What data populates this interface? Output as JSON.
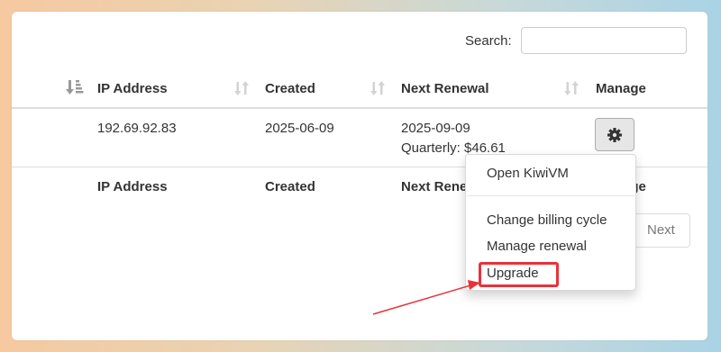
{
  "search": {
    "label": "Search:",
    "value": "",
    "placeholder": ""
  },
  "table": {
    "headers": [
      "IP Address",
      "Created",
      "Next Renewal",
      "Manage"
    ],
    "rows": [
      {
        "ip": "192.69.92.83",
        "created": "2025-06-09",
        "renewal_date": "2025-09-09",
        "renewal_cost": "Quarterly: $46.61"
      }
    ],
    "footer_headers": [
      "IP Address",
      "Created",
      "Next Renewal",
      "Manage"
    ]
  },
  "pagination": {
    "next_label": "Next"
  },
  "dropdown": {
    "items": [
      "Open KiwiVM",
      "Change billing cycle",
      "Manage renewal",
      "Upgrade"
    ]
  },
  "annotation": {
    "color": "#e8323a"
  },
  "icons": {
    "sort_active": "sort-amount-down-icon",
    "sort": "sort-icon",
    "gear": "gear-icon"
  }
}
